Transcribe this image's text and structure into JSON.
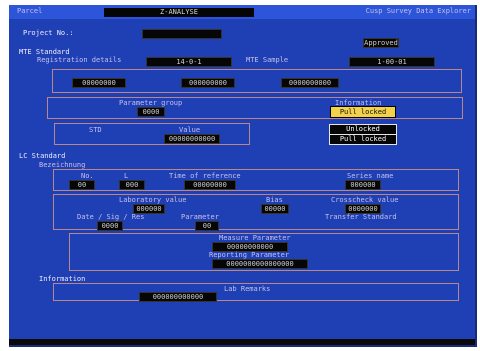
{
  "window": {
    "title_left": "Parcel",
    "title_center": "Z-ANALYSE",
    "title_right": "Cusp Survey Data Explorer"
  },
  "header": {
    "project_label": "Project No.:",
    "project_value": "",
    "status_value": "Approved"
  },
  "group_a": {
    "heading": "MTE Standard",
    "sub_label": "Registration details",
    "reg_value": "14-0-1",
    "sample_label": "MTE Sample",
    "sample_value": "1-00-01",
    "field1": "00000000",
    "field2": "000000000",
    "field3": "0000000000",
    "mid_label": "Parameter group",
    "mid_value": "0000",
    "right_label": "Information",
    "pill_label": "Pull locked",
    "dark_btn_1": "Unlocked",
    "dark_btn_2": "Pull locked",
    "small_label_1": "STD",
    "small_label_2": "Value",
    "small_field": "00000000000"
  },
  "group_b": {
    "heading": "LC Standard",
    "sub_label": "Bezeichnung",
    "label_no": "No.",
    "value_no": "00",
    "label_l": "L",
    "value_l": "000",
    "label_time": "Time of reference",
    "value_time": "00000000",
    "label_series": "Series name",
    "value_series": "000000",
    "label_val": "Laboratory value",
    "value_val": "000000",
    "label_bias": "Bias",
    "value_bias": "00000",
    "label_cross": "Crosscheck value",
    "value_cross": "0000000",
    "label_date": "Date / Sig / Res",
    "value_date": "0000",
    "label_param": "Parameter",
    "value_param": "00",
    "label_transfer": "Transfer Standard",
    "center_label_1": "Measure Parameter",
    "center_field_1": "00000000000",
    "center_label_2": "Reporting Parameter",
    "center_field_2": "0000000000000000"
  },
  "footer_group": {
    "heading": "Information",
    "label": "Lab Remarks",
    "field": "000000000000"
  }
}
